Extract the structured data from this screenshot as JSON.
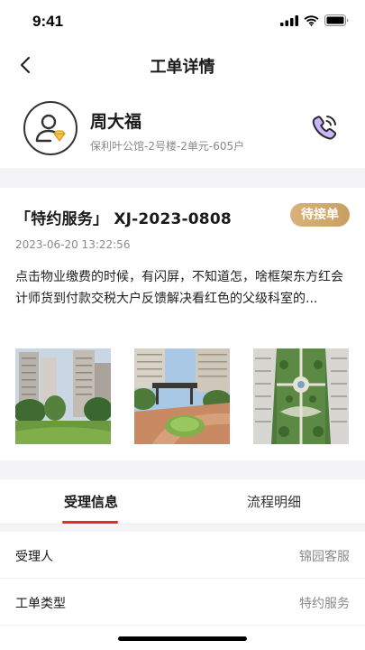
{
  "status_bar": {
    "time": "9:41"
  },
  "nav": {
    "title": "工单详情"
  },
  "customer": {
    "name": "周大福",
    "address": "保利叶公馆-2号楼-2单元-605户"
  },
  "order": {
    "title": "「特约服务」 XJ-2023-0808",
    "status": "待接单",
    "time": "2023-06-20 13:22:56",
    "description": "点击物业缴费的时候，有闪屏，不知道怎，啥框架东方红会计师货到付款交税大户反馈解决看红色的父级科室的..."
  },
  "tabs": [
    {
      "label": "受理信息"
    },
    {
      "label": "流程明细"
    }
  ],
  "info": [
    {
      "label": "受理人",
      "value": "锦园客服"
    },
    {
      "label": "工单类型",
      "value": "特约服务"
    }
  ],
  "colors": {
    "accent": "#e02b2b",
    "badge": "#d0a46a"
  }
}
